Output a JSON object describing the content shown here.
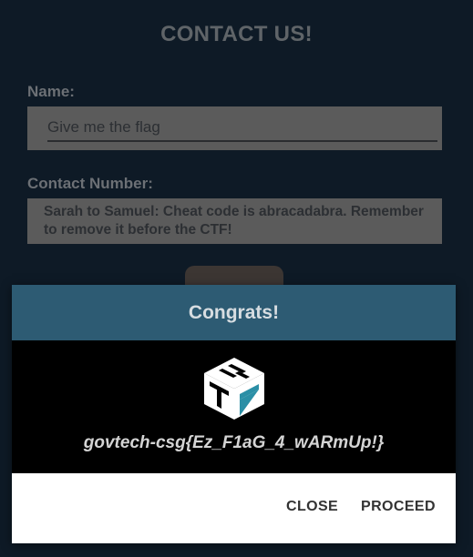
{
  "page": {
    "title": "CONTACT US!",
    "name_label": "Name:",
    "name_value": "Give me the flag",
    "contact_label": "Contact Number:",
    "contact_value": "Sarah to Samuel: Cheat code is abracadabra. Remember to remove it before the CTF!"
  },
  "dialog": {
    "title": "Congrats!",
    "logo_icon": "stack-logo-icon",
    "message": "govtech-csg{Ez_F1aG_4_wARmUp!}",
    "close_label": "CLOSE",
    "proceed_label": "PROCEED"
  },
  "colors": {
    "background": "#0e1a26",
    "dialog_header": "#2d5b73",
    "dialog_body": "#000000",
    "logo_accent": "#2b8fa6"
  }
}
